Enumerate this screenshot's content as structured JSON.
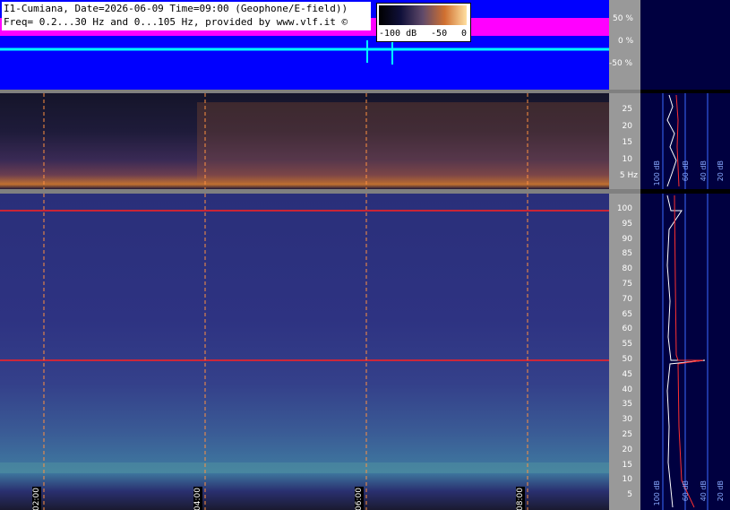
{
  "header": {
    "line1": "I1-Cumiana, Date=2026-06-09 Time=09:00 (Geophone/E-field))",
    "line2": "Freq= 0.2...30 Hz and 0...105 Hz, provided by www.vlf.it ©"
  },
  "colorbar": {
    "labels": [
      "-100 dB",
      "-50",
      "0"
    ]
  },
  "scope_axis": [
    "50 %",
    "0 %",
    "-50 %"
  ],
  "elf_axis": [
    "25",
    "20",
    "15",
    "10",
    "5 Hz"
  ],
  "vlf_axis": [
    "100",
    "95",
    "90",
    "85",
    "80",
    "75",
    "70",
    "65",
    "60",
    "55",
    "50",
    "45",
    "40",
    "35",
    "30",
    "25",
    "20",
    "15",
    "10",
    "5"
  ],
  "time_labels": [
    "02:00",
    "04:00",
    "06:00",
    "08:00"
  ],
  "profile_labels": [
    "100 dB",
    "60 dB",
    "40 dB",
    "20 dB"
  ],
  "colors": {
    "scope_bg": "#0000ff",
    "magenta": "#ff00ff",
    "cyan": "#00ffff",
    "grid_line": "#ff9040",
    "hum_line": "#ff2020",
    "axis_bg": "#999999",
    "profile_bg": "#000040"
  }
}
